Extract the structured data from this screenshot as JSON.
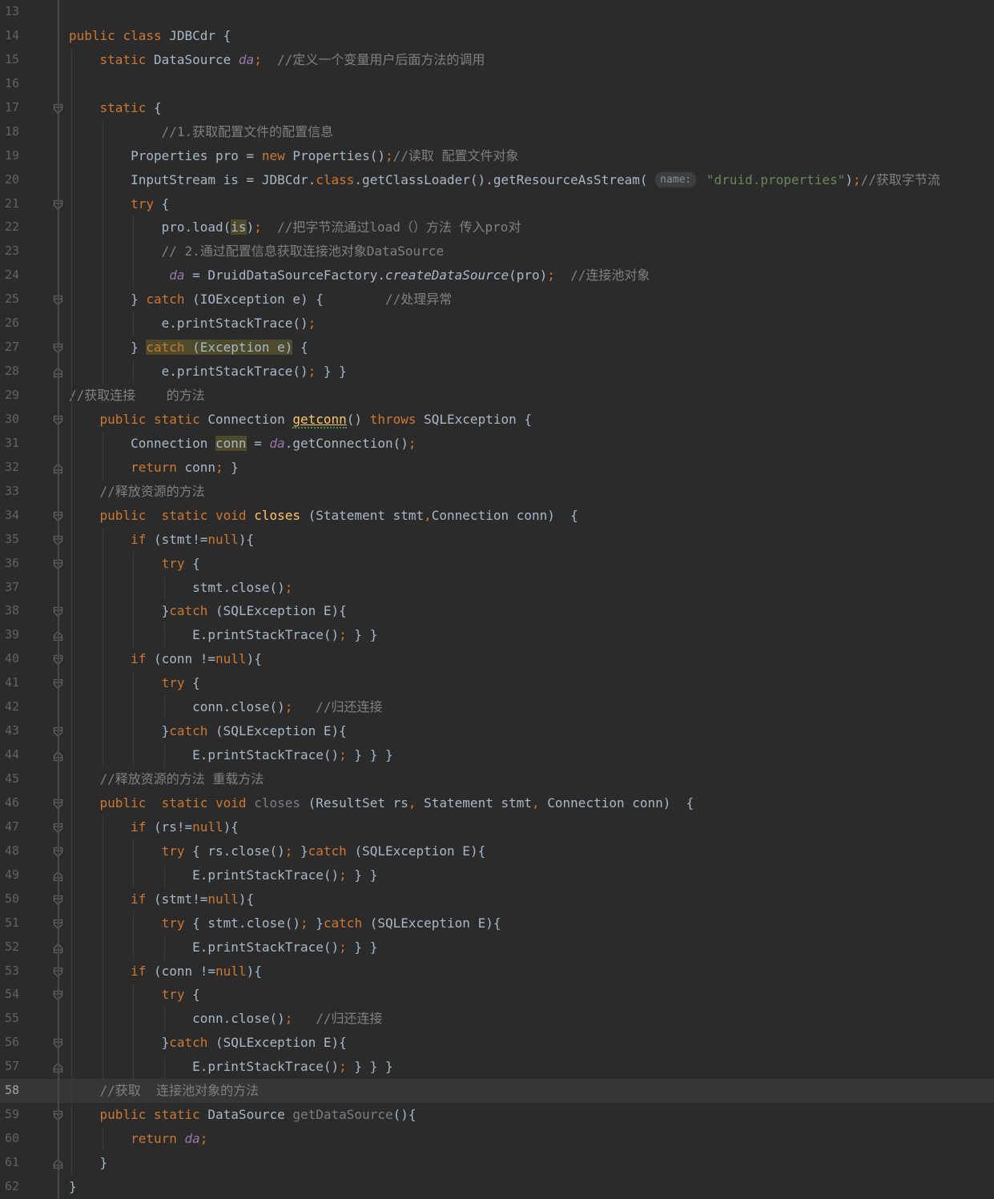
{
  "app": "code-editor",
  "palette": {
    "background": "#2b2b2b",
    "caret_line_background": "#343638",
    "line_number": "#606366",
    "line_number_active": "#a4a3a3",
    "keyword": "#cc7832",
    "plain_text": "#a9b7c6",
    "comment": "#808080",
    "string": "#6a8759",
    "static_field": "#9876aa",
    "method_declaration": "#ffc66d",
    "unused_declaration": "#7a7e85",
    "identifier_highlight": "#4e4b2d",
    "hint_badge_background": "#3c3f41",
    "hint_badge_text": "#8c8c8c"
  },
  "editor": {
    "first_line": 13,
    "last_line": 62,
    "caret_line": 58,
    "parameter_hint": "name:",
    "string_literal": "\"druid.properties\"",
    "class_name": "JDBCdr",
    "lines": [
      {
        "n": 13,
        "tk": []
      },
      {
        "n": 14,
        "tk": [
          [
            "k",
            "public"
          ],
          [
            "p",
            " "
          ],
          [
            "k",
            "class"
          ],
          [
            "p",
            " JDBCdr {"
          ]
        ]
      },
      {
        "n": 15,
        "tk": [
          [
            "p",
            "    "
          ],
          [
            "k",
            "static"
          ],
          [
            "p",
            " DataSource "
          ],
          [
            "f",
            "da"
          ],
          [
            "k",
            ";"
          ],
          [
            "c",
            "  //定义一个变量用户后面方法的调用"
          ]
        ]
      },
      {
        "n": 16,
        "tk": []
      },
      {
        "n": 17,
        "fold": "down",
        "tk": [
          [
            "p",
            "    "
          ],
          [
            "k",
            "static"
          ],
          [
            "p",
            " {"
          ]
        ]
      },
      {
        "n": 18,
        "tk": [
          [
            "p",
            "            "
          ],
          [
            "c",
            "//1.获取配置文件的配置信息"
          ]
        ]
      },
      {
        "n": 19,
        "tk": [
          [
            "p",
            "        Properties pro = "
          ],
          [
            "k",
            "new"
          ],
          [
            "p",
            " Properties()"
          ],
          [
            "k",
            ";"
          ],
          [
            "c",
            "//读取 配置文件对象"
          ]
        ]
      },
      {
        "n": 20,
        "tk": [
          [
            "p",
            "        InputStream is = JDBCdr."
          ],
          [
            "k",
            "class"
          ],
          [
            "p",
            ".getClassLoader().getResourceAsStream( "
          ],
          [
            "t",
            "name:"
          ],
          [
            "p",
            " "
          ],
          [
            "s",
            "\"druid.properties\""
          ],
          [
            "p",
            ")"
          ],
          [
            "k",
            ";"
          ],
          [
            "c",
            "//获取字节流"
          ]
        ]
      },
      {
        "n": 21,
        "fold": "down",
        "tk": [
          [
            "p",
            "        "
          ],
          [
            "k",
            "try"
          ],
          [
            "p",
            " {"
          ]
        ]
      },
      {
        "n": 22,
        "tk": [
          [
            "p",
            "            pro.load("
          ],
          [
            "p hl",
            "is"
          ],
          [
            "p",
            ")"
          ],
          [
            "k",
            ";"
          ],
          [
            "c",
            "  //把字节流通过load（）方法 传入pro对"
          ]
        ]
      },
      {
        "n": 23,
        "tk": [
          [
            "p",
            "            "
          ],
          [
            "c",
            "// 2.通过配置信息获取连接池对象DataSource"
          ]
        ]
      },
      {
        "n": 24,
        "tk": [
          [
            "p",
            "             "
          ],
          [
            "f",
            "da"
          ],
          [
            "p",
            " = DruidDataSourceFactory."
          ],
          [
            "i",
            "createDataSource"
          ],
          [
            "p",
            "(pro)"
          ],
          [
            "k",
            ";"
          ],
          [
            "c",
            "  //连接池对象"
          ]
        ]
      },
      {
        "n": 25,
        "fold": "down",
        "tk": [
          [
            "p",
            "        } "
          ],
          [
            "k",
            "catch"
          ],
          [
            "p",
            " (IOException e) {"
          ],
          [
            "c",
            "        //处理异常"
          ]
        ]
      },
      {
        "n": 26,
        "tk": [
          [
            "p",
            "            e.printStackTrace()"
          ],
          [
            "k",
            ";"
          ]
        ]
      },
      {
        "n": 27,
        "fold": "down",
        "tk": [
          [
            "p",
            "        } "
          ],
          [
            "k hl",
            "catch"
          ],
          [
            "p hl",
            " (Exception e)"
          ],
          [
            "p",
            " {"
          ]
        ]
      },
      {
        "n": 28,
        "fold": "up",
        "tk": [
          [
            "p",
            "            e.printStackTrace()"
          ],
          [
            "k",
            ";"
          ],
          [
            "p",
            " } }"
          ]
        ]
      },
      {
        "n": 29,
        "tk": [
          [
            "c",
            "//获取连接    的方法"
          ]
        ]
      },
      {
        "n": 30,
        "fold": "down",
        "tk": [
          [
            "p",
            "    "
          ],
          [
            "k",
            "public"
          ],
          [
            "p",
            " "
          ],
          [
            "k",
            "static"
          ],
          [
            "p",
            " Connection "
          ],
          [
            "d typo",
            "getconn"
          ],
          [
            "p",
            "() "
          ],
          [
            "k",
            "throws"
          ],
          [
            "p",
            " SQLException {"
          ]
        ]
      },
      {
        "n": 31,
        "tk": [
          [
            "p",
            "        Connection "
          ],
          [
            "p hl",
            "conn"
          ],
          [
            "p",
            " = "
          ],
          [
            "f",
            "da"
          ],
          [
            "p",
            ".getConnection()"
          ],
          [
            "k",
            ";"
          ]
        ]
      },
      {
        "n": 32,
        "fold": "up",
        "tk": [
          [
            "p",
            "        "
          ],
          [
            "k",
            "return"
          ],
          [
            "p",
            " conn"
          ],
          [
            "k",
            ";"
          ],
          [
            "p",
            " }"
          ]
        ]
      },
      {
        "n": 33,
        "tk": [
          [
            "p",
            "    "
          ],
          [
            "c",
            "//释放资源的方法"
          ]
        ]
      },
      {
        "n": 34,
        "fold": "down",
        "tk": [
          [
            "p",
            "    "
          ],
          [
            "k",
            "public"
          ],
          [
            "p",
            "  "
          ],
          [
            "k",
            "static"
          ],
          [
            "p",
            " "
          ],
          [
            "k",
            "void"
          ],
          [
            "p",
            " "
          ],
          [
            "d",
            "closes"
          ],
          [
            "p",
            " (Statement stmt"
          ],
          [
            "k",
            ","
          ],
          [
            "p",
            "Connection conn)  {"
          ]
        ]
      },
      {
        "n": 35,
        "fold": "down",
        "tk": [
          [
            "p",
            "        "
          ],
          [
            "k",
            "if"
          ],
          [
            "p",
            " (stmt!="
          ],
          [
            "k",
            "null"
          ],
          [
            "p",
            "){"
          ]
        ]
      },
      {
        "n": 36,
        "fold": "down",
        "tk": [
          [
            "p",
            "            "
          ],
          [
            "k",
            "try"
          ],
          [
            "p",
            " {"
          ]
        ]
      },
      {
        "n": 37,
        "tk": [
          [
            "p",
            "                stmt.close()"
          ],
          [
            "k",
            ";"
          ]
        ]
      },
      {
        "n": 38,
        "fold": "down",
        "tk": [
          [
            "p",
            "            }"
          ],
          [
            "k",
            "catch"
          ],
          [
            "p",
            " (SQLException E){"
          ]
        ]
      },
      {
        "n": 39,
        "fold": "up",
        "tk": [
          [
            "p",
            "                E.printStackTrace()"
          ],
          [
            "k",
            ";"
          ],
          [
            "p",
            " } }"
          ]
        ]
      },
      {
        "n": 40,
        "fold": "down",
        "tk": [
          [
            "p",
            "        "
          ],
          [
            "k",
            "if"
          ],
          [
            "p",
            " (conn !="
          ],
          [
            "k",
            "null"
          ],
          [
            "p",
            "){"
          ]
        ]
      },
      {
        "n": 41,
        "fold": "down",
        "tk": [
          [
            "p",
            "            "
          ],
          [
            "k",
            "try"
          ],
          [
            "p",
            " {"
          ]
        ]
      },
      {
        "n": 42,
        "tk": [
          [
            "p",
            "                conn.close()"
          ],
          [
            "k",
            ";"
          ],
          [
            "c",
            "   //归还连接"
          ]
        ]
      },
      {
        "n": 43,
        "fold": "down",
        "tk": [
          [
            "p",
            "            }"
          ],
          [
            "k",
            "catch"
          ],
          [
            "p",
            " (SQLException E){"
          ]
        ]
      },
      {
        "n": 44,
        "fold": "up",
        "tk": [
          [
            "p",
            "                E.printStackTrace()"
          ],
          [
            "k",
            ";"
          ],
          [
            "p",
            " } } }"
          ]
        ]
      },
      {
        "n": 45,
        "tk": [
          [
            "p",
            "    "
          ],
          [
            "c",
            "//释放资源的方法 重载方法"
          ]
        ]
      },
      {
        "n": 46,
        "fold": "down",
        "tk": [
          [
            "p",
            "    "
          ],
          [
            "k",
            "public"
          ],
          [
            "p",
            "  "
          ],
          [
            "k",
            "static"
          ],
          [
            "p",
            " "
          ],
          [
            "k",
            "void"
          ],
          [
            "p",
            " "
          ],
          [
            "g",
            "closes"
          ],
          [
            "p",
            " (ResultSet rs"
          ],
          [
            "k",
            ","
          ],
          [
            "p",
            " Statement stmt"
          ],
          [
            "k",
            ","
          ],
          [
            "p",
            " Connection conn)  {"
          ]
        ]
      },
      {
        "n": 47,
        "fold": "down",
        "tk": [
          [
            "p",
            "        "
          ],
          [
            "k",
            "if"
          ],
          [
            "p",
            " (rs!="
          ],
          [
            "k",
            "null"
          ],
          [
            "p",
            "){"
          ]
        ]
      },
      {
        "n": 48,
        "fold": "down",
        "tk": [
          [
            "p",
            "            "
          ],
          [
            "k",
            "try"
          ],
          [
            "p",
            " { rs.close()"
          ],
          [
            "k",
            ";"
          ],
          [
            "p",
            " }"
          ],
          [
            "k",
            "catch"
          ],
          [
            "p",
            " (SQLException E){"
          ]
        ]
      },
      {
        "n": 49,
        "fold": "up",
        "tk": [
          [
            "p",
            "                E.printStackTrace()"
          ],
          [
            "k",
            ";"
          ],
          [
            "p",
            " } }"
          ]
        ]
      },
      {
        "n": 50,
        "fold": "down",
        "tk": [
          [
            "p",
            "        "
          ],
          [
            "k",
            "if"
          ],
          [
            "p",
            " (stmt!="
          ],
          [
            "k",
            "null"
          ],
          [
            "p",
            "){"
          ]
        ]
      },
      {
        "n": 51,
        "fold": "down",
        "tk": [
          [
            "p",
            "            "
          ],
          [
            "k",
            "try"
          ],
          [
            "p",
            " { stmt.close()"
          ],
          [
            "k",
            ";"
          ],
          [
            "p",
            " }"
          ],
          [
            "k",
            "catch"
          ],
          [
            "p",
            " (SQLException E){"
          ]
        ]
      },
      {
        "n": 52,
        "fold": "up",
        "tk": [
          [
            "p",
            "                E.printStackTrace()"
          ],
          [
            "k",
            ";"
          ],
          [
            "p",
            " } }"
          ]
        ]
      },
      {
        "n": 53,
        "fold": "down",
        "tk": [
          [
            "p",
            "        "
          ],
          [
            "k",
            "if"
          ],
          [
            "p",
            " (conn !="
          ],
          [
            "k",
            "null"
          ],
          [
            "p",
            "){"
          ]
        ]
      },
      {
        "n": 54,
        "fold": "down",
        "tk": [
          [
            "p",
            "            "
          ],
          [
            "k",
            "try"
          ],
          [
            "p",
            " {"
          ]
        ]
      },
      {
        "n": 55,
        "tk": [
          [
            "p",
            "                conn.close()"
          ],
          [
            "k",
            ";"
          ],
          [
            "c",
            "   //归还连接"
          ]
        ]
      },
      {
        "n": 56,
        "fold": "down",
        "tk": [
          [
            "p",
            "            }"
          ],
          [
            "k",
            "catch"
          ],
          [
            "p",
            " (SQLException E){"
          ]
        ]
      },
      {
        "n": 57,
        "fold": "up",
        "tk": [
          [
            "p",
            "                E.printStackTrace()"
          ],
          [
            "k",
            ";"
          ],
          [
            "p",
            " } } }"
          ]
        ]
      },
      {
        "n": 58,
        "caret": true,
        "tk": [
          [
            "p",
            "    "
          ],
          [
            "c",
            "//获取  连接池对象的方法"
          ]
        ]
      },
      {
        "n": 59,
        "fold": "down",
        "tk": [
          [
            "p",
            "    "
          ],
          [
            "k",
            "public"
          ],
          [
            "p",
            " "
          ],
          [
            "k",
            "static"
          ],
          [
            "p",
            " DataSource "
          ],
          [
            "g",
            "getDataSource"
          ],
          [
            "p",
            "(){"
          ]
        ]
      },
      {
        "n": 60,
        "tk": [
          [
            "p",
            "        "
          ],
          [
            "k",
            "return"
          ],
          [
            "p",
            " "
          ],
          [
            "f",
            "da"
          ],
          [
            "k",
            ";"
          ]
        ]
      },
      {
        "n": 61,
        "fold": "up",
        "tk": [
          [
            "p",
            "    }"
          ]
        ]
      },
      {
        "n": 62,
        "tk": [
          [
            "p",
            "}"
          ]
        ]
      }
    ]
  }
}
